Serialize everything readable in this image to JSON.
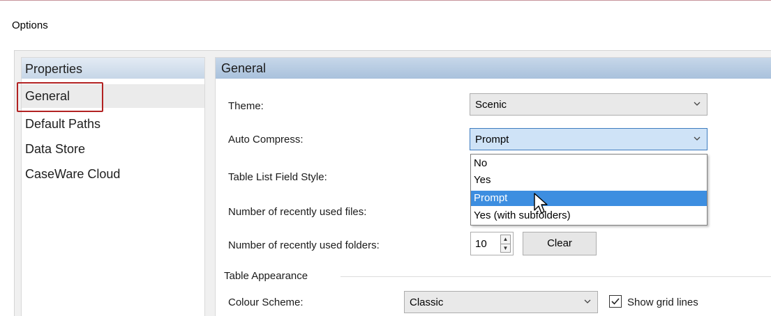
{
  "window": {
    "title": "Options"
  },
  "left_panel": {
    "header": "Properties",
    "items": [
      {
        "label": "General",
        "selected": true
      },
      {
        "label": "Default Paths",
        "selected": false
      },
      {
        "label": "Data Store",
        "selected": false
      },
      {
        "label": "CaseWare Cloud",
        "selected": false
      }
    ]
  },
  "section": {
    "header": "General",
    "theme": {
      "label": "Theme:",
      "value": "Scenic"
    },
    "auto_compress": {
      "label": "Auto Compress:",
      "value": "Prompt",
      "options": [
        "No",
        "Yes",
        "Prompt",
        "Yes (with subfolders)"
      ],
      "highlighted": "Prompt"
    },
    "table_list_field_style": {
      "label": "Table List Field Style:"
    },
    "recent_files": {
      "label": "Number of recently used files:"
    },
    "recent_folders": {
      "label": "Number of recently used folders:",
      "value": "10",
      "clear_label": "Clear"
    },
    "table_appearance": {
      "group_label": "Table Appearance",
      "colour_scheme": {
        "label": "Colour Scheme:",
        "value": "Classic"
      },
      "show_grid_lines": {
        "label": "Show grid lines",
        "checked": true
      }
    }
  },
  "colors": {
    "accent_highlight": "#3d8ee0",
    "selection_outline": "#b22222",
    "header_gradient_top": "#c7d7e9",
    "header_gradient_bottom": "#a9c1dc"
  }
}
